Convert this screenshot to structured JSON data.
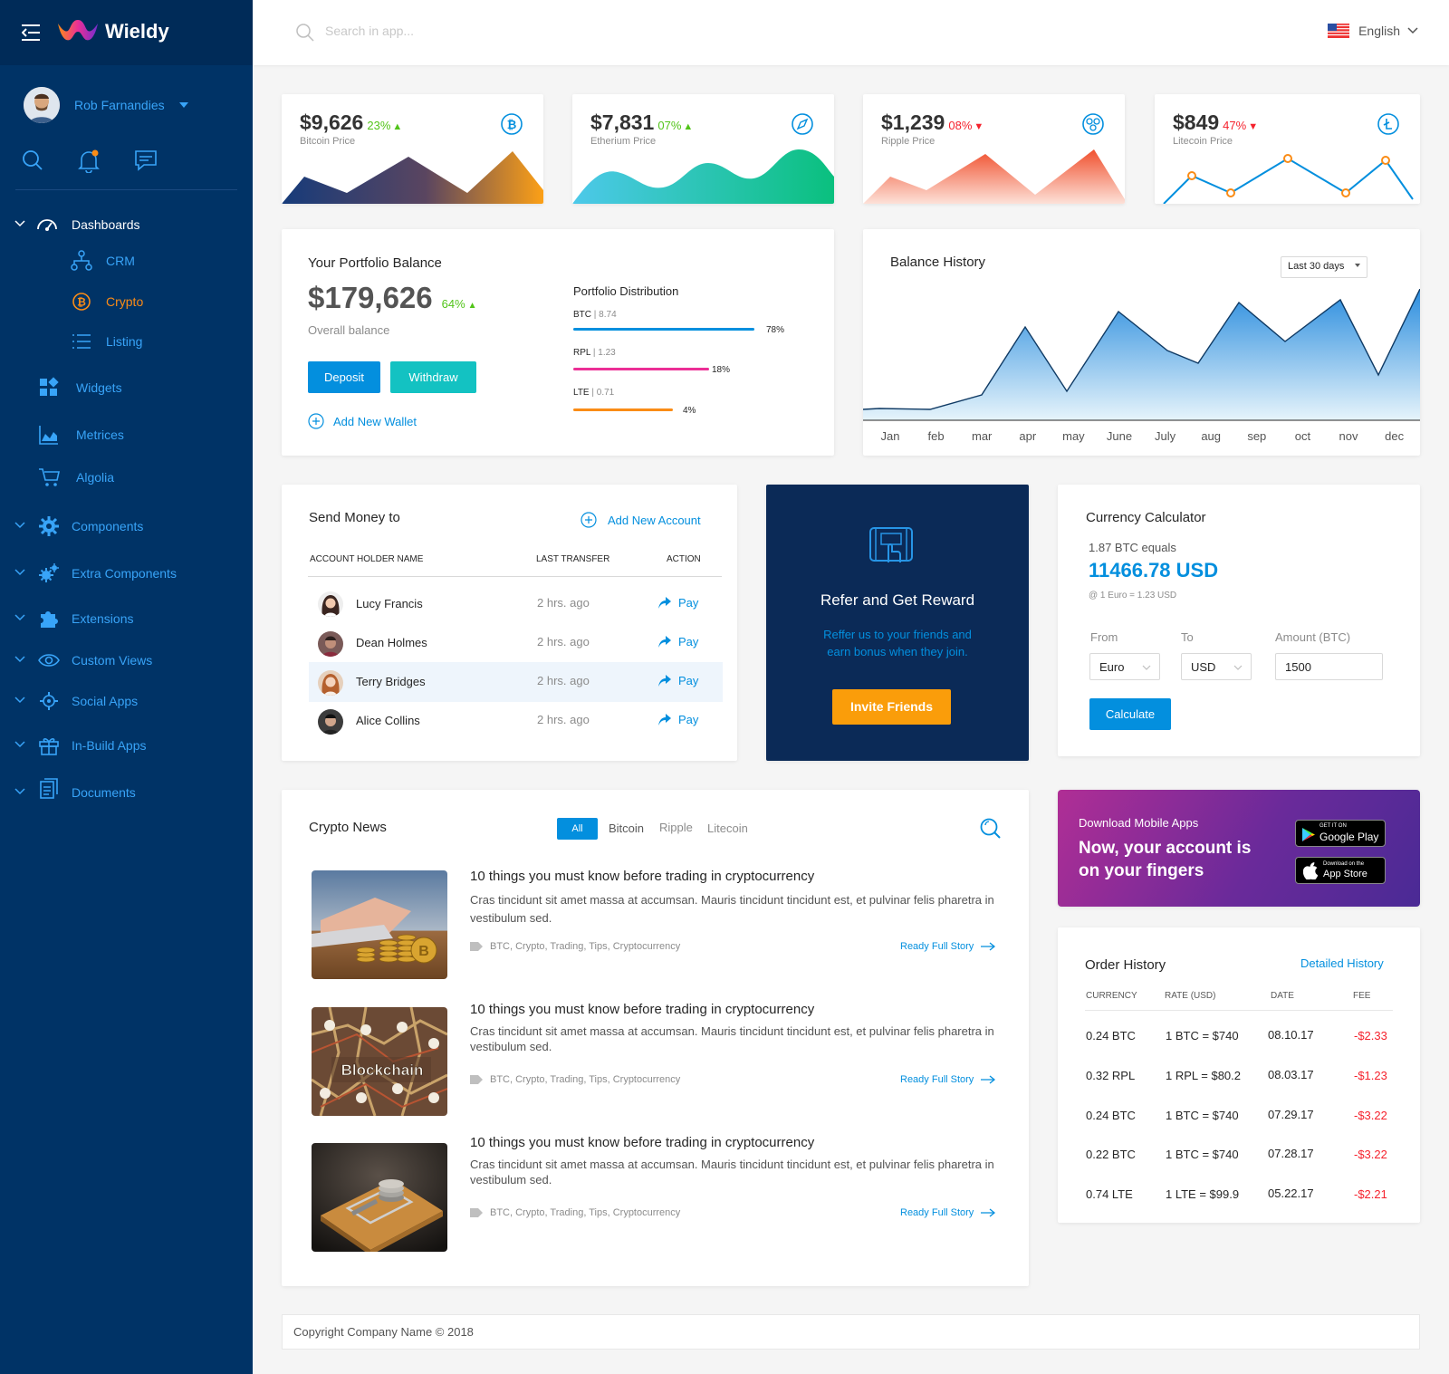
{
  "app": {
    "name": "Wieldy"
  },
  "user": {
    "name": "Rob Farnandies"
  },
  "search": {
    "placeholder": "Search in app..."
  },
  "language": {
    "selected": "English"
  },
  "sidebar": {
    "dashboards": "Dashboards",
    "crm": "CRM",
    "crypto": "Crypto",
    "listing": "Listing",
    "widgets": "Widgets",
    "metrices": "Metrices",
    "algolia": "Algolia",
    "components": "Components",
    "extra_components": "Extra Components",
    "extensions": "Extensions",
    "custom_views": "Custom Views",
    "social_apps": "Social Apps",
    "inbuild_apps": "In-Build Apps",
    "documents": "Documents"
  },
  "prices": [
    {
      "price": "$9,626",
      "change": "23%",
      "label": "Bitcoin Price",
      "trend": "up",
      "color": "#52c41a"
    },
    {
      "price": "$7,831",
      "change": "07%",
      "label": "Etherium Price",
      "trend": "up",
      "color": "#52c41a"
    },
    {
      "price": "$1,239",
      "change": "08%",
      "label": "Ripple Price",
      "trend": "down",
      "color": "#f5222d"
    },
    {
      "price": "$849",
      "change": "47%",
      "label": "Litecoin Price",
      "trend": "down",
      "color": "#f5222d"
    }
  ],
  "portfolio": {
    "title": "Your Portfolio Balance",
    "balance": "$179,626",
    "change": "64%",
    "subtitle": "Overall balance",
    "deposit": "Deposit",
    "withdraw": "Withdraw",
    "add_wallet": "Add New Wallet",
    "dist_title": "Portfolio Distribution",
    "dist": [
      {
        "coin": "BTC",
        "amount": "8.74",
        "pct": "78%",
        "value": 0.78,
        "color": "#038fde"
      },
      {
        "coin": "RPL",
        "amount": "1.23",
        "pct": "18%",
        "value": 0.18,
        "color": "#eb2f96"
      },
      {
        "coin": "LTE",
        "amount": "0.71",
        "pct": "4%",
        "value": 0.04,
        "color": "#fa8c16"
      }
    ]
  },
  "balance_history": {
    "title": "Balance History",
    "range": "Last 30 days",
    "months": [
      "Jan",
      "feb",
      "mar",
      "apr",
      "may",
      "June",
      "July",
      "aug",
      "sep",
      "oct",
      "nov",
      "dec"
    ]
  },
  "send_money": {
    "title": "Send Money to",
    "add": "Add New Account",
    "headers": [
      "ACCOUNT HOLDER NAME",
      "LAST TRANSFER",
      "ACTION"
    ],
    "rows": [
      {
        "name": "Lucy Francis",
        "time": "2 hrs. ago",
        "action": "Pay"
      },
      {
        "name": "Dean Holmes",
        "time": "2 hrs. ago",
        "action": "Pay"
      },
      {
        "name": "Terry Bridges",
        "time": "2 hrs. ago",
        "action": "Pay"
      },
      {
        "name": "Alice Collins",
        "time": "2 hrs. ago",
        "action": "Pay"
      }
    ]
  },
  "refer": {
    "title": "Refer and Get Reward",
    "text1": "Reffer us to your friends and",
    "text2": "earn bonus when they join.",
    "button": "Invite Friends"
  },
  "calculator": {
    "title": "Currency Calculator",
    "equals": "1.87 BTC equals",
    "result": "11466.78 USD",
    "rate": "@ 1 Euro = 1.23 USD",
    "from_label": "From",
    "to_label": "To",
    "amount_label": "Amount (BTC)",
    "from": "Euro",
    "to": "USD",
    "amount": "1500",
    "button": "Calculate"
  },
  "news": {
    "title": "Crypto News",
    "tabs": [
      "All",
      "Bitcoin",
      "Ripple",
      "Litecoin"
    ],
    "items": [
      {
        "title": "10 things you must know before trading in cryptocurrency",
        "body": "Cras tincidunt sit amet massa at accumsan. Mauris tincidunt tincidunt est, et pulvinar felis pharetra in vestibulum sed.",
        "tags": "BTC, Crypto, Trading, Tips, Cryptocurrency",
        "link": "Ready Full Story"
      },
      {
        "title": "10 things you must know before trading in cryptocurrency",
        "body": "Cras tincidunt sit amet massa at accumsan. Mauris tincidunt tincidunt est, et pulvinar felis pharetra in vestibulum sed.",
        "tags": "BTC, Crypto, Trading, Tips, Cryptocurrency",
        "link": "Ready Full Story",
        "image_text": "Blockchain"
      },
      {
        "title": "10 things you must know before trading in cryptocurrency",
        "body": "Cras tincidunt sit amet massa at accumsan. Mauris tincidunt tincidunt est, et pulvinar felis pharetra in vestibulum sed.",
        "tags": "BTC, Crypto, Trading, Tips, Cryptocurrency",
        "link": "Ready Full Story"
      }
    ]
  },
  "apps": {
    "label": "Download Mobile Apps",
    "title1": "Now, your account is",
    "title2": "on your fingers",
    "google_small": "GET IT ON",
    "google": "Google Play",
    "apple_small": "Download on the",
    "apple": "App Store"
  },
  "orders": {
    "title": "Order History",
    "link": "Detailed History",
    "headers": [
      "CURRENCY",
      "RATE (USD)",
      "DATE",
      "FEE"
    ],
    "rows": [
      {
        "currency": "0.24 BTC",
        "rate": "1 BTC = $740",
        "date": "08.10.17",
        "fee": "-$2.33"
      },
      {
        "currency": "0.32 RPL",
        "rate": "1 RPL = $80.2",
        "date": "08.03.17",
        "fee": "-$1.23"
      },
      {
        "currency": "0.24 BTC",
        "rate": "1 BTC = $740",
        "date": "07.29.17",
        "fee": "-$3.22"
      },
      {
        "currency": "0.22 BTC",
        "rate": "1 BTC = $740",
        "date": "07.28.17",
        "fee": "-$3.22"
      },
      {
        "currency": "0.74 LTE",
        "rate": "1 LTE = $99.9",
        "date": "05.22.17",
        "fee": "-$2.21"
      }
    ]
  },
  "footer": {
    "text": "Copyright Company Name © 2018"
  }
}
